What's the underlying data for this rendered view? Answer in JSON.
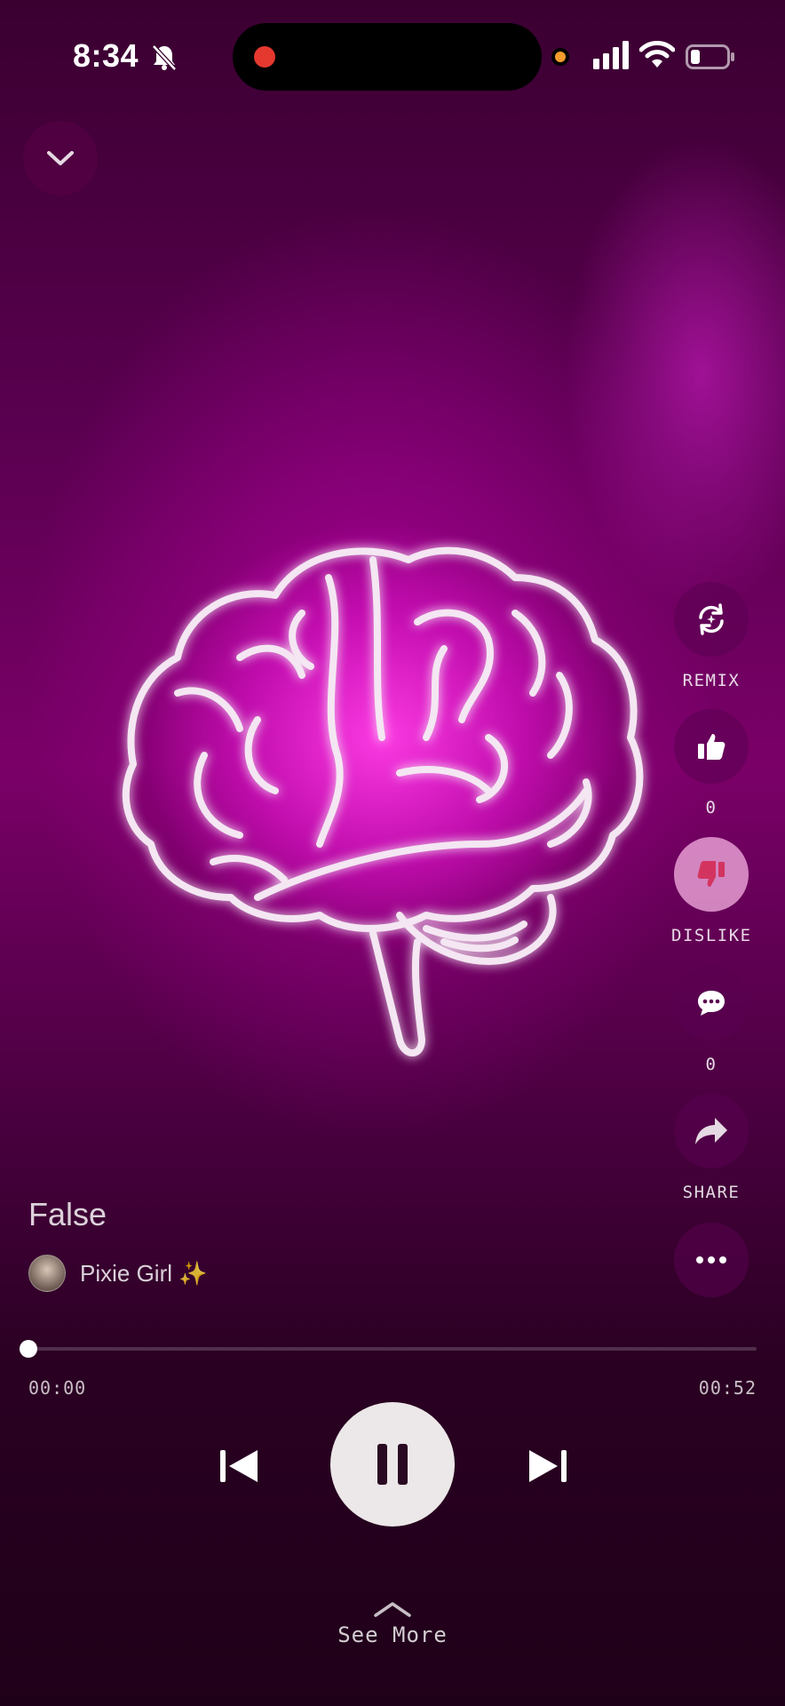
{
  "status_bar": {
    "time": "8:34",
    "icons": [
      "bell-slash-icon",
      "signal-icon",
      "wifi-icon",
      "battery-icon"
    ]
  },
  "header": {
    "collapse_icon": "chevron-down-icon"
  },
  "actions": [
    {
      "icon": "remix-icon",
      "label": "REMIX"
    },
    {
      "icon": "thumbs-up-icon",
      "label": "0"
    },
    {
      "icon": "thumbs-down-icon",
      "label": "DISLIKE",
      "active": true
    },
    {
      "icon": "comment-icon",
      "label": "0"
    },
    {
      "icon": "share-icon",
      "label": "SHARE"
    },
    {
      "icon": "more-icon",
      "label": ""
    }
  ],
  "track": {
    "title": "False",
    "artist": "Pixie Girl ✨",
    "elapsed": "00:00",
    "duration": "00:52",
    "progress": 0
  },
  "controls": {
    "prev_icon": "skip-previous-icon",
    "play_icon": "pause-icon",
    "next_icon": "skip-next-icon"
  },
  "footer": {
    "see_more": "See More"
  },
  "colors": {
    "accent": "#e020d0",
    "background": "#3a0030"
  }
}
